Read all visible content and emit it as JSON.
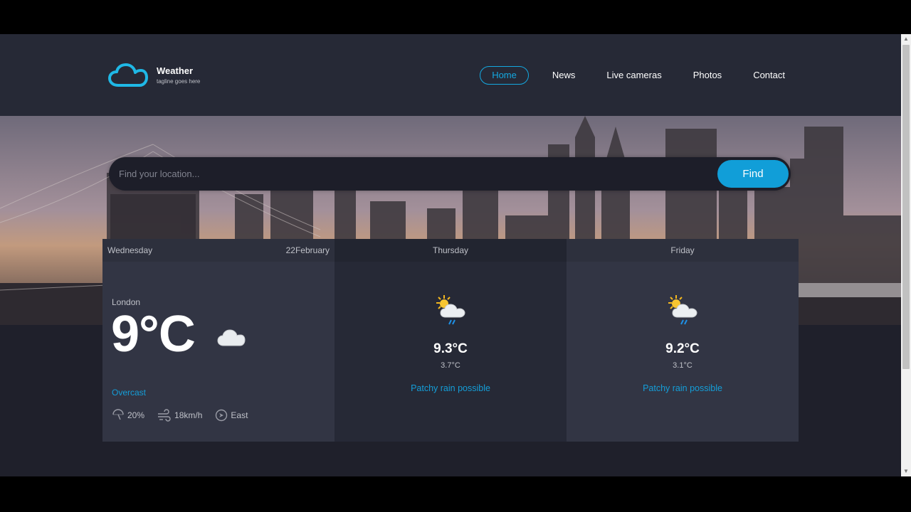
{
  "brand": {
    "title": "Weather",
    "tagline": "tagline goes here"
  },
  "nav": [
    {
      "label": "Home",
      "active": true
    },
    {
      "label": "News"
    },
    {
      "label": "Live cameras"
    },
    {
      "label": "Photos"
    },
    {
      "label": "Contact"
    }
  ],
  "search": {
    "placeholder": "Find your location...",
    "button": "Find"
  },
  "today": {
    "day": "Wednesday",
    "date": "22February",
    "location": "London",
    "temp": "9°C",
    "icon": "cloud-icon",
    "condition": "Overcast",
    "rain": "20%",
    "wind": "18km/h",
    "direction": "East"
  },
  "forecast": [
    {
      "day": "Thursday",
      "icon": "sun-cloud-rain-icon",
      "high": "9.3°C",
      "low": "3.7°C",
      "condition": "Patchy rain possible"
    },
    {
      "day": "Friday",
      "icon": "sun-cloud-rain-icon",
      "high": "9.2°C",
      "low": "3.1°C",
      "condition": "Patchy rain possible"
    }
  ],
  "colors": {
    "accent": "#149ed8",
    "header": "#262936",
    "panel": "#323544",
    "background": "#1f202b"
  }
}
